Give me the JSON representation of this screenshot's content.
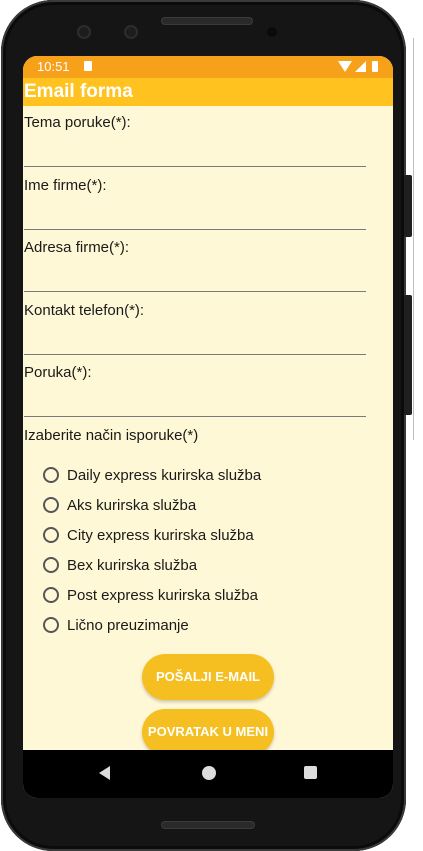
{
  "status": {
    "time": "10:51"
  },
  "app_bar": {
    "title": "Email forma"
  },
  "fields": [
    {
      "label": "Tema poruke(*):",
      "value": ""
    },
    {
      "label": "Ime firme(*):",
      "value": ""
    },
    {
      "label": "Adresa firme(*):",
      "value": ""
    },
    {
      "label": "Kontakt telefon(*):",
      "value": ""
    },
    {
      "label": "Poruka(*):",
      "value": ""
    }
  ],
  "delivery": {
    "title": "Izaberite način isporuke(*)",
    "options": [
      "Daily express kurirska služba",
      "Aks kurirska služba",
      "City express kurirska služba",
      "Bex kurirska služba",
      "Post express kurirska služba",
      "Lično preuzimanje"
    ]
  },
  "buttons": {
    "send": "POŠALJI E-MAIL",
    "back": "POVRATAK U MENI"
  },
  "colors": {
    "status_bar": "#f7a11a",
    "app_bar": "#ffc21f",
    "background": "#fff8d6",
    "button": "#f5bf22"
  },
  "icons": {
    "status": [
      "sd-card-icon",
      "wifi-icon",
      "signal-icon",
      "battery-icon"
    ],
    "nav": [
      "back-icon",
      "home-icon",
      "recents-icon"
    ]
  }
}
